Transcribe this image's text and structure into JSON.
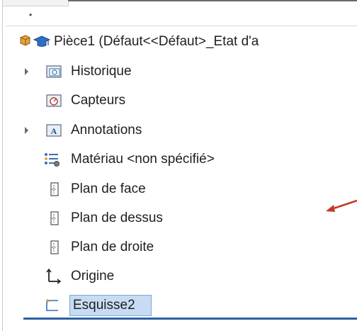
{
  "tree": {
    "root_label": "Pièce1  (Défaut<<Défaut>_Etat d'a",
    "items": [
      {
        "label": "Historique",
        "icon": "history-folder-icon",
        "expandable": true
      },
      {
        "label": "Capteurs",
        "icon": "sensors-folder-icon",
        "expandable": false
      },
      {
        "label": "Annotations",
        "icon": "annotations-folder-icon",
        "expandable": true
      },
      {
        "label": "Matériau <non spécifié>",
        "icon": "material-icon",
        "expandable": false
      },
      {
        "label": "Plan de face",
        "icon": "plane-icon",
        "expandable": false
      },
      {
        "label": "Plan de dessus",
        "icon": "plane-icon",
        "expandable": false
      },
      {
        "label": "Plan de droite",
        "icon": "plane-icon",
        "expandable": false
      },
      {
        "label": "Origine",
        "icon": "origin-icon",
        "expandable": false
      },
      {
        "label": "Esquisse2",
        "icon": "sketch-icon",
        "expandable": false,
        "selected": true
      }
    ]
  },
  "colors": {
    "selection_bg": "#c7dcf2",
    "selection_border": "#7aa7d8",
    "annotation_arrow": "#c0392b",
    "underline": "#2d5fa6"
  }
}
